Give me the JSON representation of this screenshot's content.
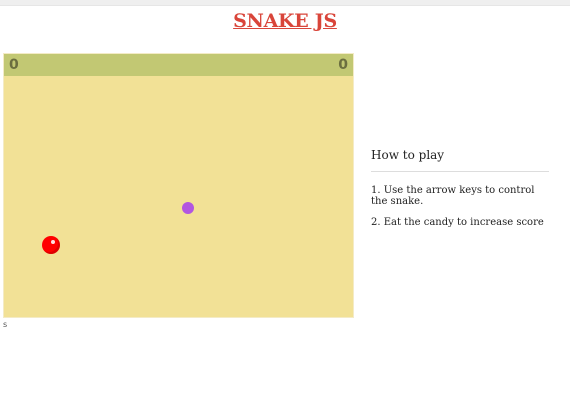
{
  "page": {
    "title": "SNAKE JS"
  },
  "scoreboard": {
    "left_score": "0",
    "right_score": "0"
  },
  "footer": {
    "label": "s"
  },
  "instructions": {
    "heading": "How to play",
    "items": [
      "1. Use the arrow keys to control the snake.",
      "2. Eat the candy to increase score"
    ]
  },
  "colors": {
    "title": "#d9453a",
    "board": "#f2e196",
    "scorebar": "#c2c873",
    "candy": "#b256e0",
    "snake": "#ff0000"
  },
  "icons": {
    "candy": "candy-dot",
    "snake": "snake-head"
  }
}
